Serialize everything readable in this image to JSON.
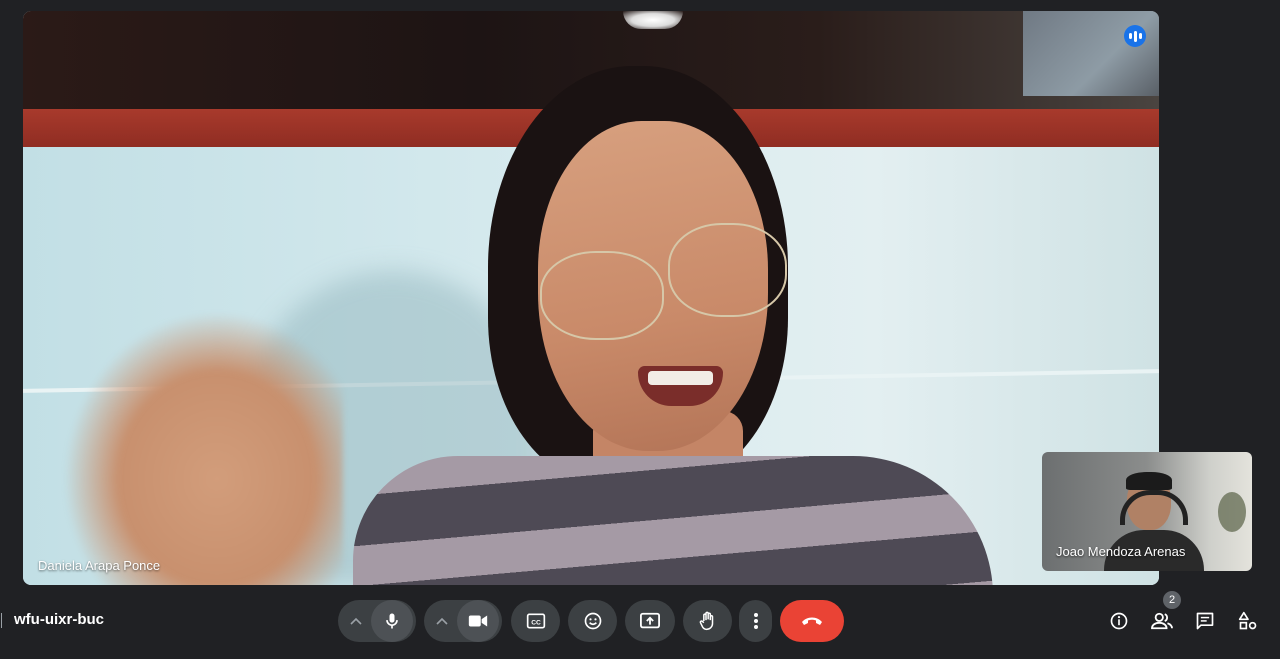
{
  "meeting": {
    "code": "wfu-uixr-buc"
  },
  "participants": {
    "main": {
      "name": "Daniela Arapa Ponce"
    },
    "self": {
      "name": "Joao Mendoza Arenas"
    },
    "count": "2"
  },
  "controls": {
    "mic_icon": "microphone-icon",
    "camera_icon": "video-camera-icon",
    "captions_icon": "closed-captions-icon",
    "reactions_icon": "emoji-icon",
    "present_icon": "present-screen-icon",
    "hand_icon": "raise-hand-icon",
    "more_icon": "more-vertical-icon",
    "end_icon": "end-call-icon"
  },
  "colors": {
    "background": "#202124",
    "control_bg": "#3c4043",
    "end_call": "#ea4335",
    "speaking": "#1a73e8"
  }
}
